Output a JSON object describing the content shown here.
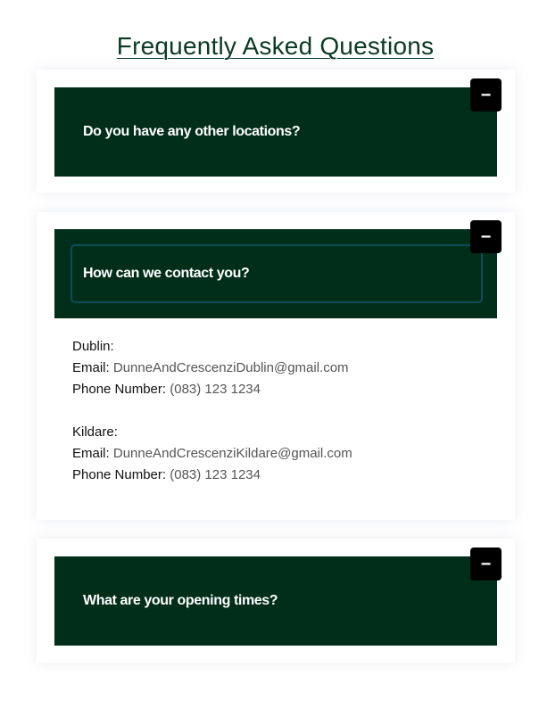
{
  "page": {
    "title": "Frequently Asked Questions"
  },
  "faq": {
    "items": [
      {
        "question": "Do you have any other locations?",
        "toggle": "−"
      },
      {
        "question": "How can we contact you?",
        "toggle": "−"
      },
      {
        "question": "What are your opening times?",
        "toggle": "−"
      }
    ],
    "contact": {
      "dublin": {
        "heading": "Dublin:",
        "email_label": "Email:",
        "email": "DunneAndCrescenziDublin@gmail.com",
        "phone_label": "Phone Number:",
        "phone": "(083) 123 1234"
      },
      "kildare": {
        "heading": "Kildare:",
        "email_label": "Email:",
        "email": "DunneAndCrescenziKildare@gmail.com",
        "phone_label": "Phone Number:",
        "phone": "(083) 123 1234"
      }
    }
  },
  "colors": {
    "header_bg": "#012e1b",
    "title": "#0a3a24",
    "toggle_bg": "#000000"
  },
  "icons": {
    "toggle": "minus-icon"
  }
}
